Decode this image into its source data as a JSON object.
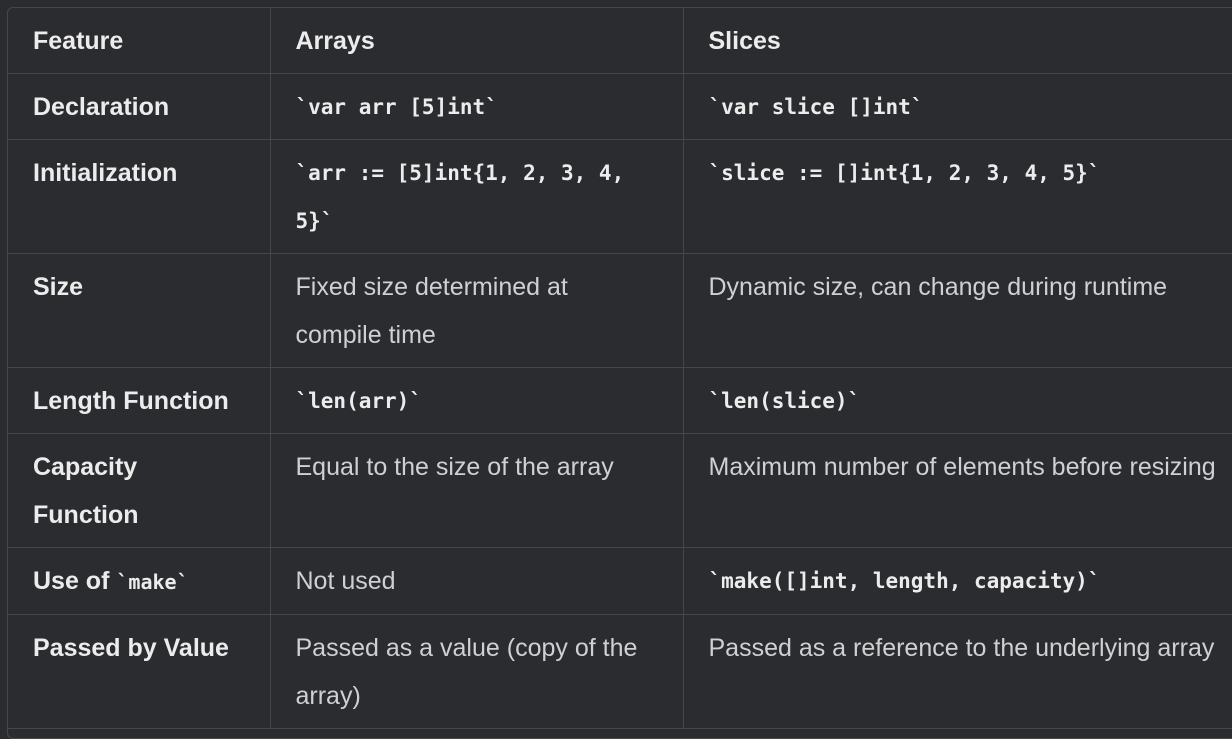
{
  "table": {
    "headers": [
      "Feature",
      "Arrays",
      "Slices"
    ],
    "rows": [
      {
        "feature": "Declaration",
        "arrays": "`var arr [5]int`",
        "slices": "`var slice []int`"
      },
      {
        "feature": "Initialization",
        "arrays": "`arr := [5]int{1, 2, 3, 4, 5}`",
        "slices": "`slice := []int{1, 2, 3, 4, 5}`"
      },
      {
        "feature": "Size",
        "arrays": "Fixed size determined at compile time",
        "slices": "Dynamic size, can change during runtime"
      },
      {
        "feature": "Length Function",
        "arrays": "`len(arr)`",
        "slices": "`len(slice)`"
      },
      {
        "feature": "Capacity Function",
        "arrays": "Equal to the size of the array",
        "slices": "Maximum number of elements before resizing"
      },
      {
        "feature_prefix": "Use of ",
        "feature_code": "`make`",
        "arrays": "Not used",
        "slices": "`make([]int, length, capacity)`"
      },
      {
        "feature": "Passed by Value",
        "arrays": "Passed as a value (copy of the array)",
        "slices": "Passed as a reference to the underlying array"
      }
    ]
  }
}
